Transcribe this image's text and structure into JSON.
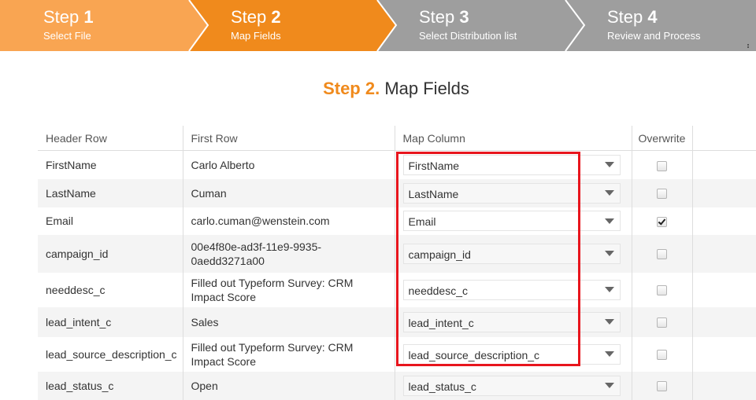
{
  "wizard": {
    "steps": [
      {
        "word": "Step",
        "num": "1",
        "label": "Select File",
        "state": "done",
        "color": "#f9a552"
      },
      {
        "word": "Step",
        "num": "2",
        "label": "Map Fields",
        "state": "active",
        "color": "#f08a1c"
      },
      {
        "word": "Step",
        "num": "3",
        "label": "Select Distribution list",
        "state": "pending",
        "color": "#9e9e9e"
      },
      {
        "word": "Step",
        "num": "4",
        "label": "Review and Process",
        "state": "pending",
        "color": "#9e9e9e"
      }
    ]
  },
  "heading": {
    "accent": "Step 2.",
    "text": "Map Fields",
    "accent_color": "#f08a1c"
  },
  "table": {
    "headers": {
      "header_row": "Header Row",
      "first_row": "First Row",
      "map_column": "Map Column",
      "overwrite": "Overwrite"
    },
    "rows": [
      {
        "header": "FirstName",
        "first": "Carlo Alberto",
        "map": "FirstName",
        "overwrite": false
      },
      {
        "header": "LastName",
        "first": "Cuman",
        "map": "LastName",
        "overwrite": false
      },
      {
        "header": "Email",
        "first": "carlo.cuman@wenstein.com",
        "map": "Email",
        "overwrite": true
      },
      {
        "header": "campaign_id",
        "first": "00e4f80e-ad3f-11e9-9935-0aedd3271a00",
        "map": "campaign_id",
        "overwrite": false
      },
      {
        "header": "needdesc_c",
        "first": "Filled out Typeform Survey: CRM Impact Score",
        "map": "needdesc_c",
        "overwrite": false
      },
      {
        "header": "lead_intent_c",
        "first": "Sales",
        "map": "lead_intent_c",
        "overwrite": false
      },
      {
        "header": "lead_source_description_c",
        "first": "Filled out Typeform Survey: CRM Impact Score",
        "map": "lead_source_description_c",
        "overwrite": false
      },
      {
        "header": "lead_status_c",
        "first": "Open",
        "map": "lead_status_c",
        "overwrite": false
      }
    ]
  },
  "highlight_color": "#e8151d"
}
